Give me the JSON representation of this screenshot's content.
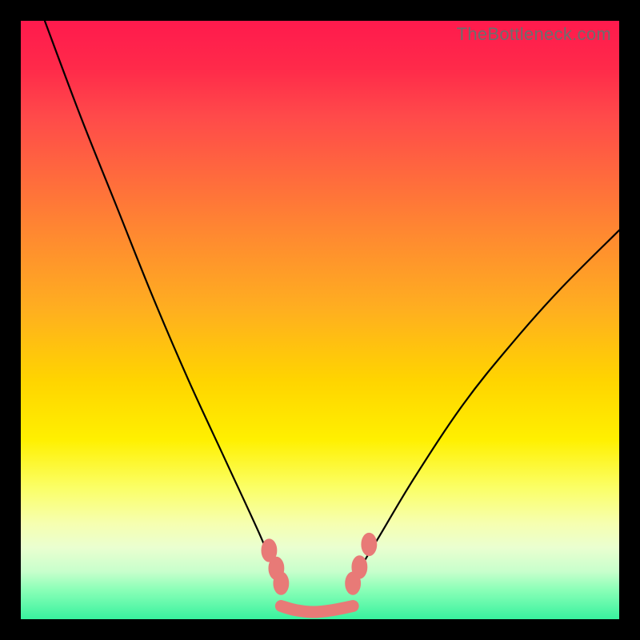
{
  "watermark": "TheBottleneck.com",
  "chart_data": {
    "type": "line",
    "title": "",
    "xlabel": "",
    "ylabel": "",
    "xlim": [
      0,
      100
    ],
    "ylim": [
      0,
      100
    ],
    "grid": false,
    "series": [
      {
        "name": "left-curve",
        "x": [
          4,
          10,
          16,
          22,
          28,
          34,
          40,
          42,
          43.5
        ],
        "values": [
          100,
          84,
          69,
          54,
          40,
          27,
          14,
          9,
          6
        ]
      },
      {
        "name": "right-curve",
        "x": [
          55.5,
          57,
          60,
          66,
          74,
          82,
          90,
          100
        ],
        "values": [
          6,
          9,
          14,
          24,
          36,
          46,
          55,
          65
        ]
      },
      {
        "name": "trough",
        "x": [
          43.5,
          46,
          49,
          52,
          55.5
        ],
        "values": [
          2.2,
          1.5,
          1.2,
          1.5,
          2.2
        ]
      }
    ],
    "markers": [
      {
        "x": 41.5,
        "y": 11.5
      },
      {
        "x": 42.7,
        "y": 8.5
      },
      {
        "x": 43.5,
        "y": 6.0
      },
      {
        "x": 55.5,
        "y": 6.0
      },
      {
        "x": 56.6,
        "y": 8.7
      },
      {
        "x": 58.2,
        "y": 12.5
      }
    ],
    "marker_radius": 1.4,
    "colors": {
      "curve": "#000000",
      "markers": "#e87a77",
      "trough": "#e87a77"
    }
  }
}
